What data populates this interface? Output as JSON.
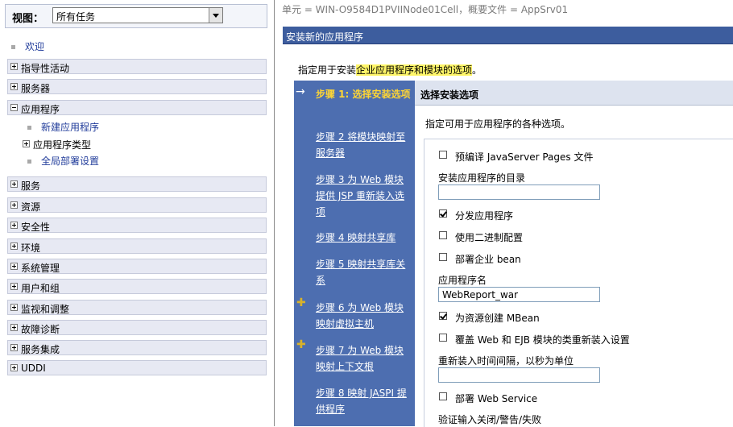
{
  "nav": {
    "view_label": "视图：",
    "view_value": "所有任务",
    "welcome": "欢迎",
    "sections": [
      {
        "label": "指导性活动",
        "expanded": false
      },
      {
        "label": "服务器",
        "expanded": false
      },
      {
        "label": "应用程序",
        "expanded": true
      },
      {
        "label": "服务",
        "expanded": false
      },
      {
        "label": "资源",
        "expanded": false
      },
      {
        "label": "安全性",
        "expanded": false
      },
      {
        "label": "环境",
        "expanded": false
      },
      {
        "label": "系统管理",
        "expanded": false
      },
      {
        "label": "用户和组",
        "expanded": false
      },
      {
        "label": "监视和调整",
        "expanded": false
      },
      {
        "label": "故障诊断",
        "expanded": false
      },
      {
        "label": "服务集成",
        "expanded": false
      },
      {
        "label": "UDDI",
        "expanded": false
      }
    ],
    "app_children": {
      "new_app": "新建应用程序",
      "app_types": "应用程序类型",
      "global_deploy": "全局部署设置"
    }
  },
  "breadcrumb": "单元 = WIN-O9584D1PVIINode01Cell，概要文件 = AppSrv01",
  "panel_title": "安装新的应用程序",
  "intro": {
    "pre": "指定用于安装",
    "highlight": "企业应用程序和模块的选项",
    "post": "。"
  },
  "steps": [
    {
      "text": "步骤 1: 选择安装选项",
      "current": true
    },
    {
      "text": "步骤 2  将模块映射至服务器"
    },
    {
      "text": "步骤 3  为 Web 模块提供 JSP 重新装入选项"
    },
    {
      "text": "步骤 4  映射共享库"
    },
    {
      "text": "步骤 5  映射共享库关系"
    },
    {
      "text": "步骤 6  为 Web 模块映射虚拟主机"
    },
    {
      "text": "步骤 7  为 Web 模块映射上下文根"
    },
    {
      "text": "步骤 8  映射 JASPI 提供程序"
    }
  ],
  "options": {
    "heading": "选择安装选项",
    "description": "指定可用于应用程序的各种选项。",
    "precompile": "预编译 JavaServer Pages 文件",
    "install_dir": "安装应用程序的目录",
    "install_dir_value": "",
    "distribute": "分发应用程序",
    "binary": "使用二进制配置",
    "deploy_ejb": "部署企业 bean",
    "app_name": "应用程序名",
    "app_name_value": "WebReport_war",
    "mbean": "为资源创建 MBean",
    "override": "覆盖 Web 和 EJB 模块的类重新装入设置",
    "reload_interval": "重新装入时间间隔，以秒为单位",
    "reload_interval_value": "",
    "deploy_ws": "部署 Web Service",
    "validate": "验证输入关闭/警告/失败"
  }
}
